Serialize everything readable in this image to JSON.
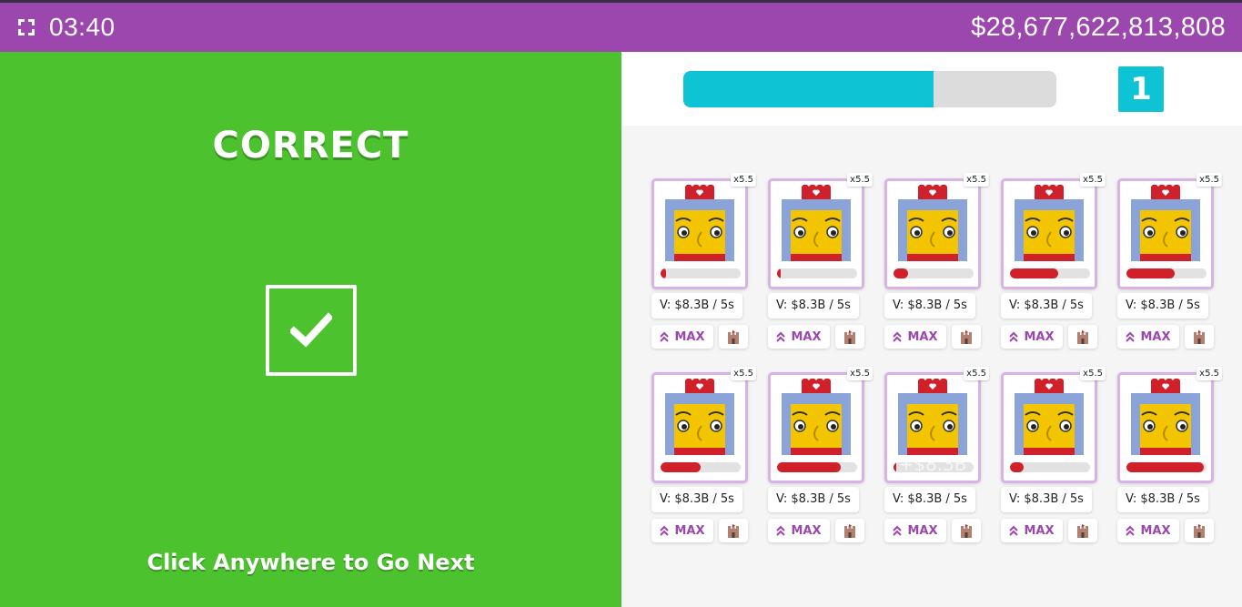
{
  "header": {
    "timer": "03:40",
    "money": "$28,677,622,813,808"
  },
  "feedback": {
    "title": "CORRECT",
    "instruction": "Click Anywhere to Go Next"
  },
  "progress": {
    "fraction": 0.67,
    "level": "1"
  },
  "cards": [
    {
      "multiplier": "x5.5",
      "value": "V: $8.3B / 5s",
      "max_label": "MAX",
      "hp": 0.07
    },
    {
      "multiplier": "x5.5",
      "value": "V: $8.3B / 5s",
      "max_label": "MAX",
      "hp": 0.05
    },
    {
      "multiplier": "x5.5",
      "value": "V: $8.3B / 5s",
      "max_label": "MAX",
      "hp": 0.18
    },
    {
      "multiplier": "x5.5",
      "value": "V: $8.3B / 5s",
      "max_label": "MAX",
      "hp": 0.6
    },
    {
      "multiplier": "x5.5",
      "value": "V: $8.3B / 5s",
      "max_label": "MAX",
      "hp": 0.6
    },
    {
      "multiplier": "x5.5",
      "value": "V: $8.3B / 5s",
      "max_label": "MAX",
      "hp": 0.5
    },
    {
      "multiplier": "x5.5",
      "value": "V: $8.3B / 5s",
      "max_label": "MAX",
      "hp": 0.8
    },
    {
      "multiplier": "x5.5",
      "value": "V: $8.3B / 5s",
      "max_label": "MAX",
      "hp": 0.03,
      "floating": "+$8.3B"
    },
    {
      "multiplier": "x5.5",
      "value": "V: $8.3B / 5s",
      "max_label": "MAX",
      "hp": 0.17
    },
    {
      "multiplier": "x5.5",
      "value": "V: $8.3B / 5s",
      "max_label": "MAX",
      "hp": 0.97
    }
  ],
  "colors": {
    "header": "#9b47ad",
    "correct_bg": "#4cc22f",
    "accent": "#0ec4d4",
    "hp": "#d0212b"
  },
  "icons": {
    "fullscreen": "fullscreen-icon",
    "check": "checkmark-icon",
    "upgrade": "double-chevron-up-icon",
    "castle": "castle-icon"
  }
}
